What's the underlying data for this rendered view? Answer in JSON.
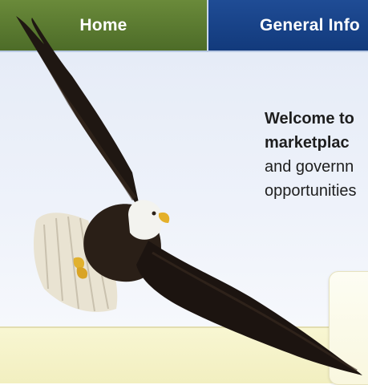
{
  "nav": {
    "home_label": "Home",
    "general_info_label": "General Info"
  },
  "intro": {
    "line1": "Welcome to",
    "line2": "marketplac",
    "line3": "and governn",
    "line4": "opportunities"
  }
}
